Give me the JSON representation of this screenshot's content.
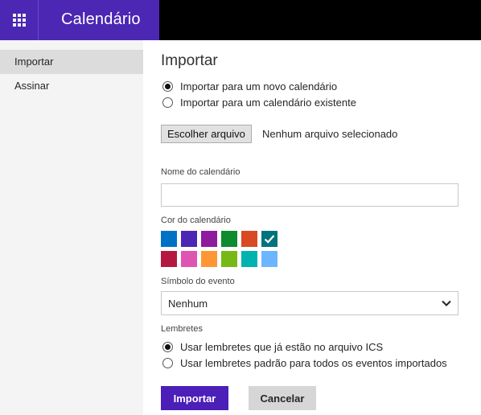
{
  "app": {
    "title": "Calendário"
  },
  "sidebar": {
    "items": [
      {
        "label": "Importar",
        "active": true
      },
      {
        "label": "Assinar",
        "active": false
      }
    ]
  },
  "main": {
    "title": "Importar",
    "import_options": [
      {
        "label": "Importar para um novo calendário",
        "checked": true
      },
      {
        "label": "Importar para um calendário existente",
        "checked": false
      }
    ],
    "file": {
      "button_label": "Escolher arquivo",
      "status": "Nenhum arquivo selecionado"
    },
    "calendar_name": {
      "label": "Nome do calendário",
      "value": "",
      "placeholder": ""
    },
    "calendar_color": {
      "label": "Cor do calendário",
      "swatches": [
        "#0072c6",
        "#4b27b3",
        "#8e1b9e",
        "#0e8a2f",
        "#d84a24",
        "#00727c",
        "#b31940",
        "#de54b2",
        "#ff9635",
        "#77b816",
        "#00b2b0",
        "#6cb6ff"
      ],
      "selected_color": "#00727c"
    },
    "event_symbol": {
      "label": "Símbolo do evento",
      "value": "Nenhum"
    },
    "reminders": {
      "label": "Lembretes",
      "options": [
        {
          "label": "Usar lembretes que já estão no arquivo ICS",
          "checked": true
        },
        {
          "label": "Usar lembretes padrão para todos os eventos importados",
          "checked": false
        }
      ]
    },
    "actions": {
      "import_label": "Importar",
      "cancel_label": "Cancelar"
    }
  },
  "colors": {
    "brand": "#4b27b3",
    "topbar": "#000000",
    "primary_button": "#4b1fb8"
  }
}
